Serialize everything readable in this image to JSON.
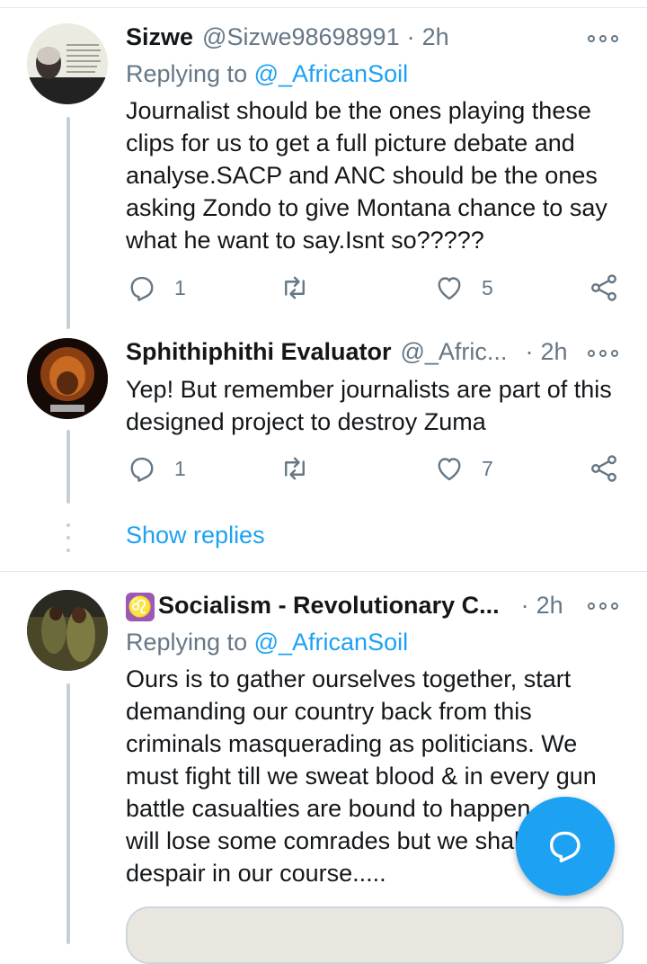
{
  "tweets": [
    {
      "name": "Sizwe",
      "handle": "@Sizwe98698991",
      "time": "2h",
      "replying_label": "Replying to",
      "replying_handle": "@_AfricanSoil",
      "text": "Journalist should be the ones playing these clips for us to get a full picture debate and analyse.SACP and ANC should be the ones asking Zondo to give Montana chance to say what he want to say.Isnt so?????",
      "replies": "1",
      "likes": "5"
    },
    {
      "name": "Sphithiphithi Evaluator",
      "handle": "@_Afric...",
      "time": "2h",
      "text": "Yep! But remember journalists are part of this designed project to destroy Zuma",
      "replies": "1",
      "likes": "7"
    },
    {
      "name_emoji": "♌",
      "name": "Socialism - Revolutionary C...",
      "time": "2h",
      "replying_label": "Replying to",
      "replying_handle": "@_AfricanSoil",
      "text": "Ours is to gather ourselves together, start demanding our country back from this criminals masquerading as politicians. We must fight till we sweat blood & in every gun battle casualties are bound to happen, we will lose some comrades but we shall not despair in our course....."
    }
  ],
  "show_replies": "Show replies",
  "colors": {
    "accent": "#1da1f2",
    "secondary_text": "#657786",
    "thread_line": "#c4cfd6"
  },
  "icons": [
    "reply-icon",
    "retweet-icon",
    "like-icon",
    "share-icon",
    "more-icon",
    "compose-icon"
  ]
}
